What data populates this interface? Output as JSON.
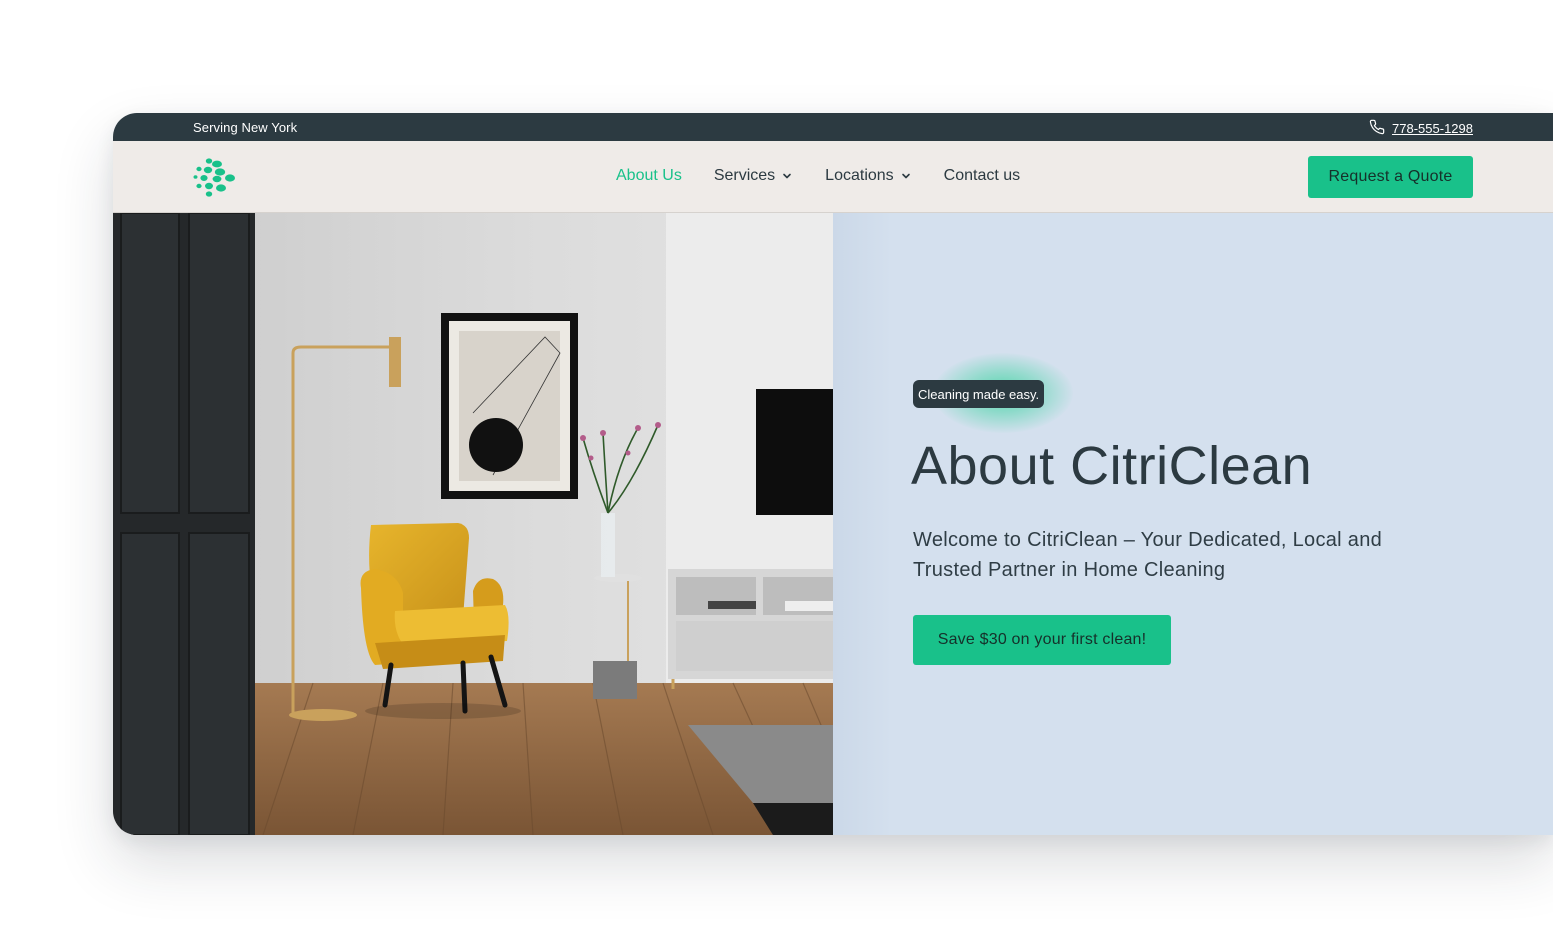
{
  "topbar": {
    "serving": "Serving New York",
    "phone": "778-555-1298",
    "phone_icon": "phone-icon"
  },
  "nav": {
    "logo_icon": "citriclean-logo-icon",
    "items": [
      {
        "label": "About Us",
        "active": true,
        "has_dropdown": false
      },
      {
        "label": "Services",
        "active": false,
        "has_dropdown": true
      },
      {
        "label": "Locations",
        "active": false,
        "has_dropdown": true
      },
      {
        "label": "Contact us",
        "active": false,
        "has_dropdown": false
      }
    ],
    "quote_button": "Request a Quote"
  },
  "hero": {
    "badge": "Cleaning made easy.",
    "title": "About CitriClean",
    "subtitle": "Welcome to CitriClean – Your Dedicated, Local and Trusted Partner in Home Cleaning",
    "cta": "Save $30 on your first clean!"
  },
  "colors": {
    "accent": "#19c18a",
    "dark": "#2c3a41",
    "nav_bg": "#efebe8",
    "hero_bg": "#d4e0ee"
  }
}
